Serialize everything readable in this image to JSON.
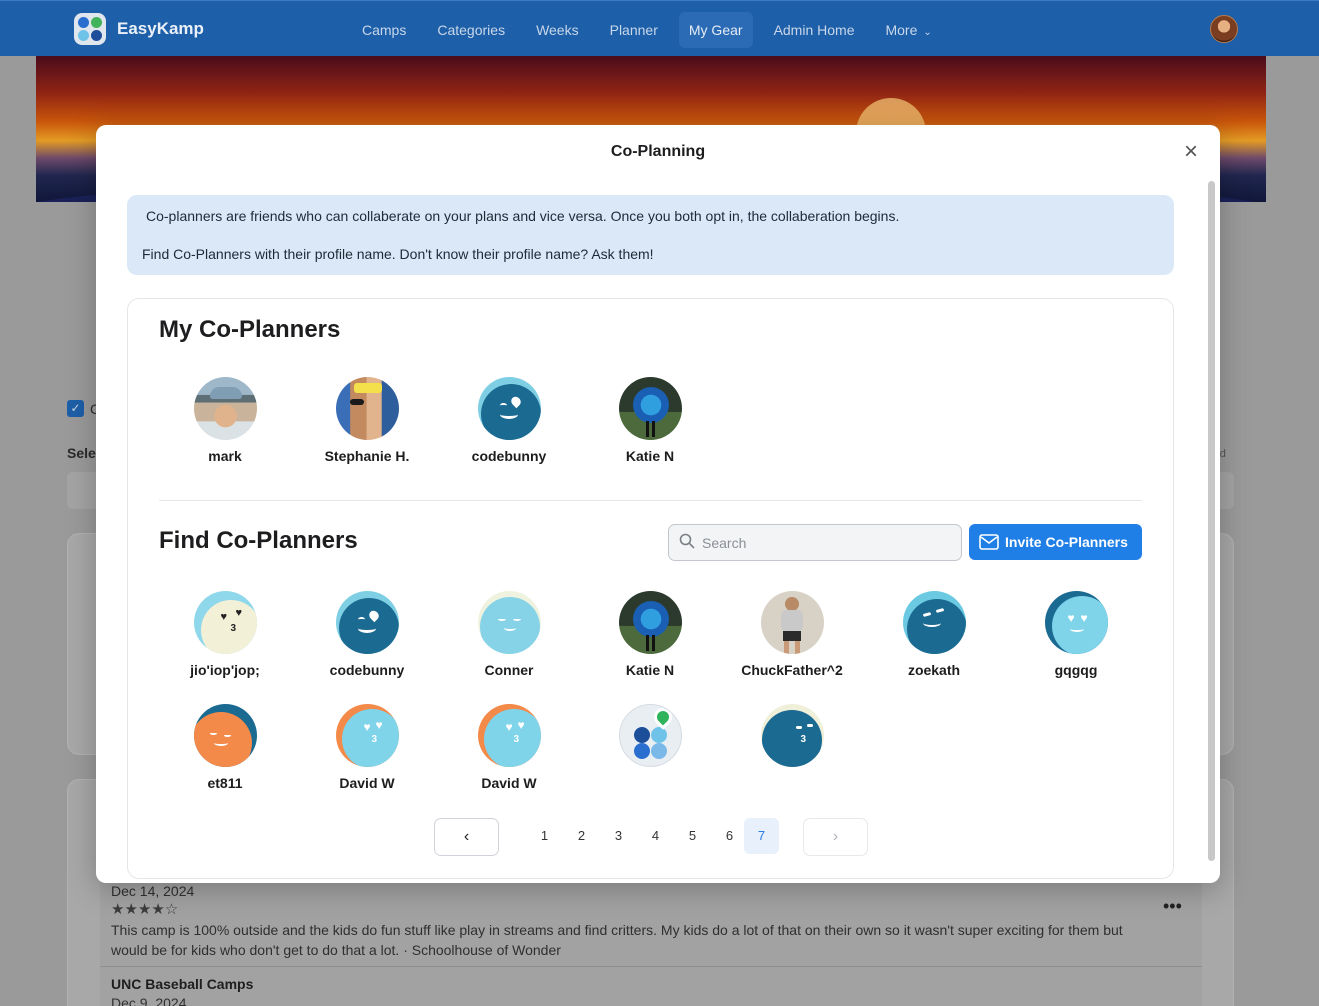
{
  "nav": {
    "brand": "EasyKamp",
    "links": [
      "Camps",
      "Categories",
      "Weeks",
      "Planner",
      "My Gear",
      "Admin Home",
      "More"
    ],
    "active": "My Gear"
  },
  "background": {
    "checkbox_fragment": "C",
    "select_fragment": "Sele",
    "right_fragment": "red",
    "review1": {
      "date": "Dec 14, 2024",
      "stars": "★★★★☆",
      "rating": 4,
      "text": "This camp is 100% outside and the kids do fun stuff like play in streams and find critters.  My kids do a lot of that on their own so it wasn't super exciting for them but would be for kids who don't get to do that a lot.  · Schoolhouse of Wonder"
    },
    "review2": {
      "title": "UNC Baseball Camps",
      "date": "Dec 9, 2024"
    }
  },
  "modal": {
    "title": "Co-Planning",
    "close_symbol": "×",
    "info_line1": "Co-planners are friends who can collaberate on your plans and vice versa.  Once you both opt in, the collaberation begins.",
    "info_line2": "Find Co-Planners with their profile name. Don't know their profile name? Ask them!",
    "my_heading": "My Co-Planners",
    "my_coplanners": [
      {
        "name": "mark",
        "avatar": "photo-man-cap"
      },
      {
        "name": "Stephanie H.",
        "avatar": "photo-couple"
      },
      {
        "name": "codebunny",
        "avatar": "face-navy-wink"
      },
      {
        "name": "Katie N",
        "avatar": "photo-blue-costume"
      }
    ],
    "find_heading": "Find Co-Planners",
    "search_placeholder": "Search",
    "invite_label": "Invite Co-Planners",
    "find_results": [
      {
        "name": "jio'iop'jop;",
        "avatar": "face-cream-hearts"
      },
      {
        "name": "codebunny",
        "avatar": "face-navy-wink"
      },
      {
        "name": "Conner",
        "avatar": "face-light-smile"
      },
      {
        "name": "Katie N",
        "avatar": "photo-blue-costume"
      },
      {
        "name": "ChuckFather^2",
        "avatar": "photo-runner"
      },
      {
        "name": "zoekath",
        "avatar": "face-navy-smile"
      },
      {
        "name": "gqgqg",
        "avatar": "face-cyan-hearts"
      },
      {
        "name": "et811",
        "avatar": "face-orange-smile"
      },
      {
        "name": "David W",
        "avatar": "face-cyan-hearts-orange"
      },
      {
        "name": "David W",
        "avatar": "face-cyan-hearts-orange"
      },
      {
        "name": "",
        "avatar": "logo-easykamp"
      },
      {
        "name": "",
        "avatar": "face-navy-kiss"
      }
    ],
    "pagination": {
      "prev_symbol": "‹",
      "next_symbol": "›",
      "pages": [
        "1",
        "2",
        "3",
        "4",
        "5",
        "6",
        "7"
      ],
      "current": "7"
    }
  },
  "colors": {
    "nav_bg": "#1d5fa8",
    "accent": "#1f7fe6",
    "info_bg": "#dbe8f7",
    "active_page_bg": "#e7f0fb"
  }
}
